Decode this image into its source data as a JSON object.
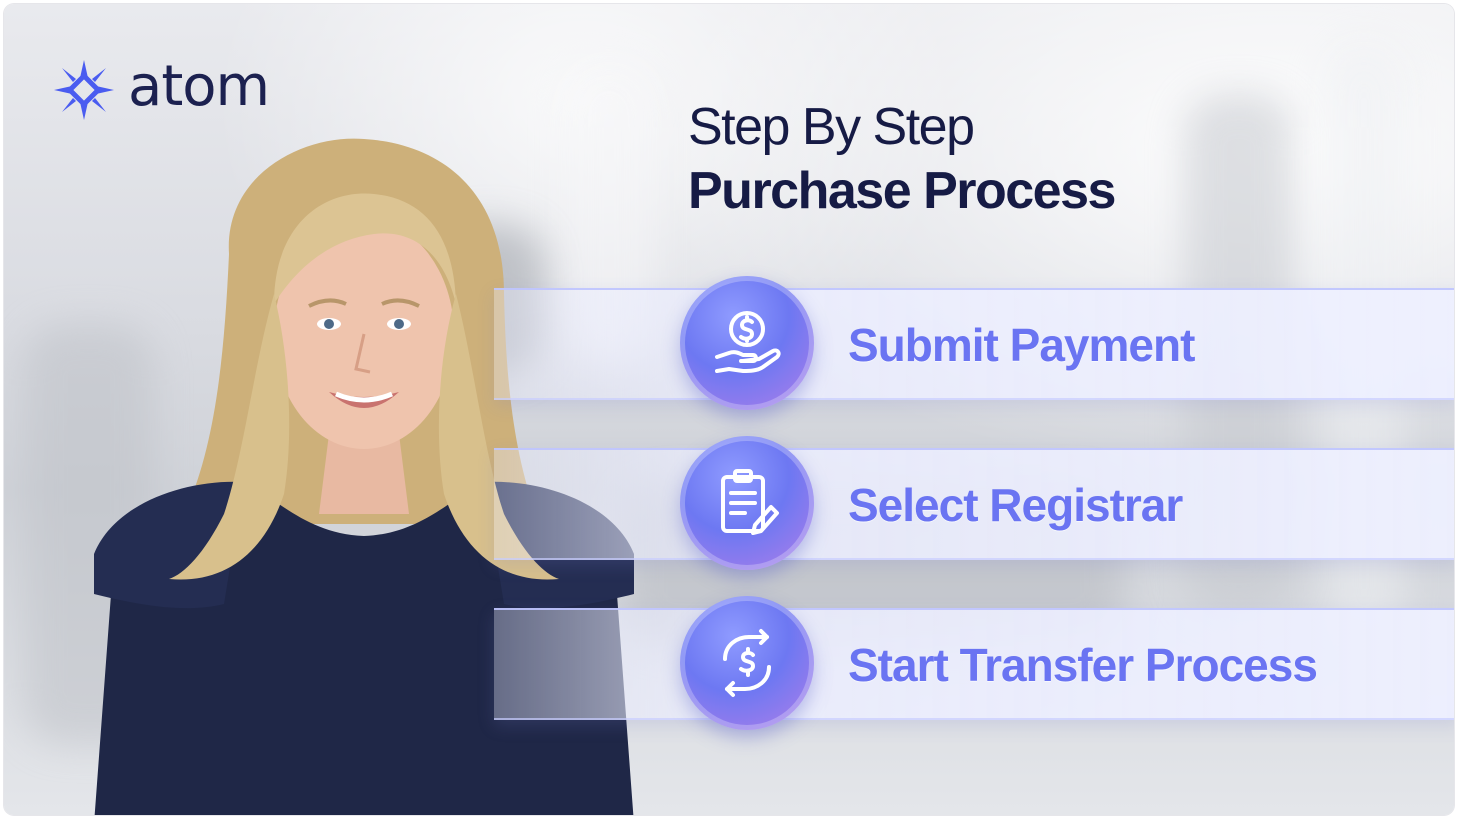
{
  "logo": {
    "text": "atom",
    "icon": "atom-star-icon",
    "color": "#4a5cf0"
  },
  "heading": {
    "line1": "Step By Step",
    "line2": "Purchase Process"
  },
  "steps": [
    {
      "label": "Submit Payment",
      "icon": "hand-dollar-coin-icon"
    },
    {
      "label": "Select Registrar",
      "icon": "clipboard-pen-icon"
    },
    {
      "label": "Start Transfer Process",
      "icon": "dollar-transfer-arrows-icon"
    }
  ],
  "colors": {
    "heading": "#161b45",
    "step_text": "#6a74f2",
    "step_circle": "#6d78f2",
    "dress": "#1f2747",
    "hair": "#d8c08c"
  }
}
